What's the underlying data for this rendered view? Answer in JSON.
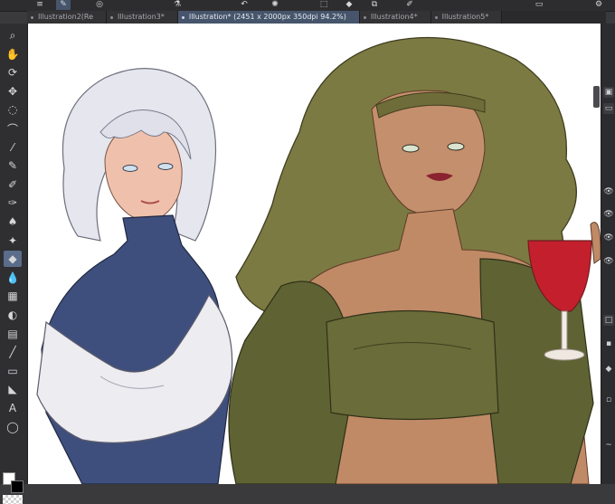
{
  "tabs": [
    {
      "label": "Illustration2(Re",
      "active": false
    },
    {
      "label": "Illustration3*",
      "active": false
    },
    {
      "label": "Illustration* (2451 x 2000px 350dpi 94.2%)",
      "active": true
    },
    {
      "label": "Illustration4*",
      "active": false
    },
    {
      "label": "Illustration5*",
      "active": false
    }
  ],
  "tools": [
    {
      "icon": "zoom-icon",
      "glyph": "⌕"
    },
    {
      "icon": "hand-icon",
      "glyph": "✋"
    },
    {
      "icon": "rotate-icon",
      "glyph": "⟳"
    },
    {
      "icon": "move-icon",
      "glyph": "✥"
    },
    {
      "icon": "lasso-icon",
      "glyph": "◌"
    },
    {
      "icon": "auto-select-icon",
      "glyph": "⌒"
    },
    {
      "icon": "eyedropper-icon",
      "glyph": "⁄"
    },
    {
      "icon": "pen-icon",
      "glyph": "✎"
    },
    {
      "icon": "pencil-icon",
      "glyph": "✐"
    },
    {
      "icon": "brush-icon",
      "glyph": "✑"
    },
    {
      "icon": "airbrush-icon",
      "glyph": "♠"
    },
    {
      "icon": "decoration-icon",
      "glyph": "✦"
    },
    {
      "icon": "eraser-icon",
      "glyph": "◆"
    },
    {
      "icon": "blend-icon",
      "glyph": "💧"
    },
    {
      "icon": "fill-icon",
      "glyph": "▦"
    },
    {
      "icon": "bucket-icon",
      "glyph": "◐"
    },
    {
      "icon": "gradient-icon",
      "glyph": "▤"
    },
    {
      "icon": "line-icon",
      "glyph": "╱"
    },
    {
      "icon": "frame-icon",
      "glyph": "▭"
    },
    {
      "icon": "ruler-icon",
      "glyph": "◣"
    },
    {
      "icon": "text-icon",
      "glyph": "A"
    },
    {
      "icon": "balloon-icon",
      "glyph": "◯"
    }
  ],
  "colors": {
    "main": "#ffffff",
    "sub": "#000000",
    "accent": "#5b6d8a"
  }
}
